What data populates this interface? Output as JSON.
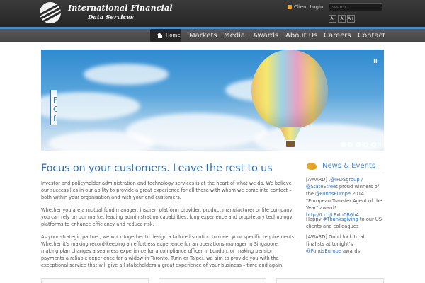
{
  "header": {
    "logo_name": "International Financial",
    "logo_subtitle": "Data Services",
    "client_login": "Client Login",
    "search_placeholder": "search...",
    "font_buttons": [
      "A-",
      "A",
      "A+"
    ]
  },
  "nav": {
    "home": "Home",
    "items": [
      "Markets",
      "Media",
      "Awards",
      "About Us",
      "Careers",
      "Contact"
    ]
  },
  "hero": {
    "panel_text": "F\nC\nfr",
    "slide_count": 5,
    "active_slide": 1
  },
  "main": {
    "headline": "Focus on your customers. Leave the rest to us",
    "paragraphs": [
      "Investor and policyholder administration and technology services is at the heart of what we do.  We believe our success lies in our ability to provide a great experience for all those with whom we come into contact – both within your organisation and with your end customers.",
      "Whether you are a mutual fund manager, insurer, platform provider, product manufacturer or life company, you can rely on our market leading administration capabilities, long experience and proprietary technology platforms to enhance efficiency and reduce risk.",
      "As your strategic partner, we work together to design a tailored solution to meet your specific requirements.  Whether it's making record-keeping an effortless experience for an operations manager in Singapore, making plan changes a seamless experience for a compliance officer in London, or making pension payments a reliable experience for a widow in Toronto, Turin or Taipei, we aim to provide you with the exceptional service that will give all stakeholders a great experience of your business – time and again."
    ]
  },
  "sidebar": {
    "title": "News & Events",
    "tweets": [
      {
        "prefix": "[AWARD] ",
        "link1": ".@IFDSgroup / @StateStreet",
        "text1": " proud winners of the ",
        "link2": "@FundsEurope",
        "text2": " 2014 \"European Transfer Agent of the Year\" award! ",
        "link3": "http://t.co/LFxIh0B6hA"
      },
      {
        "prefix": "Happy ",
        "link1": "#Thanksgiving",
        "text1": " to our US clients and colleagues",
        "link2": "",
        "text2": "",
        "link3": ""
      },
      {
        "prefix": "[AWARD] Good luck to all finalists at tonight's ",
        "link1": "@FundsEurope",
        "text1": " awards",
        "link2": "",
        "text2": "",
        "link3": ""
      }
    ]
  }
}
